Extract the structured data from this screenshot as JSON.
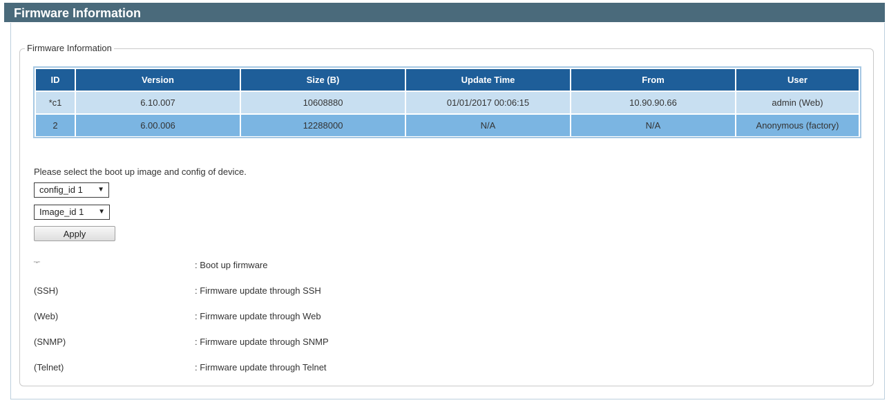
{
  "header": {
    "title": "Firmware Information"
  },
  "section": {
    "legend": "Firmware Information"
  },
  "table": {
    "columns": [
      "ID",
      "Version",
      "Size (B)",
      "Update Time",
      "From",
      "User"
    ],
    "rows": [
      [
        "*c1",
        "6.10.007",
        "10608880",
        "01/01/2017 00:06:15",
        "10.90.90.66",
        "admin (Web)"
      ],
      [
        "2",
        "6.00.006",
        "12288000",
        "N/A",
        "N/A",
        "Anonymous (factory)"
      ]
    ]
  },
  "boot": {
    "prompt": "Please select the boot up image and config of device.",
    "config_select": "config_id 1",
    "image_select": "Image_id 1",
    "apply_label": "Apply"
  },
  "notes": [
    {
      "symbol": "\"*\"",
      "description": ": Boot up firmware"
    },
    {
      "symbol": "(SSH)",
      "description": ": Firmware update through SSH"
    },
    {
      "symbol": "(Web)",
      "description": ": Firmware update through Web"
    },
    {
      "symbol": "(SNMP)",
      "description": ": Firmware update through SNMP"
    },
    {
      "symbol": "(Telnet)",
      "description": ": Firmware update through Telnet"
    }
  ],
  "icons": {
    "dropdown": "chevron-down-icon"
  },
  "colors": {
    "title_bar": "#4a6a7b",
    "table_header": "#1e5e99",
    "row_light": "#c8dff1",
    "row_dark": "#7bb5e2"
  }
}
